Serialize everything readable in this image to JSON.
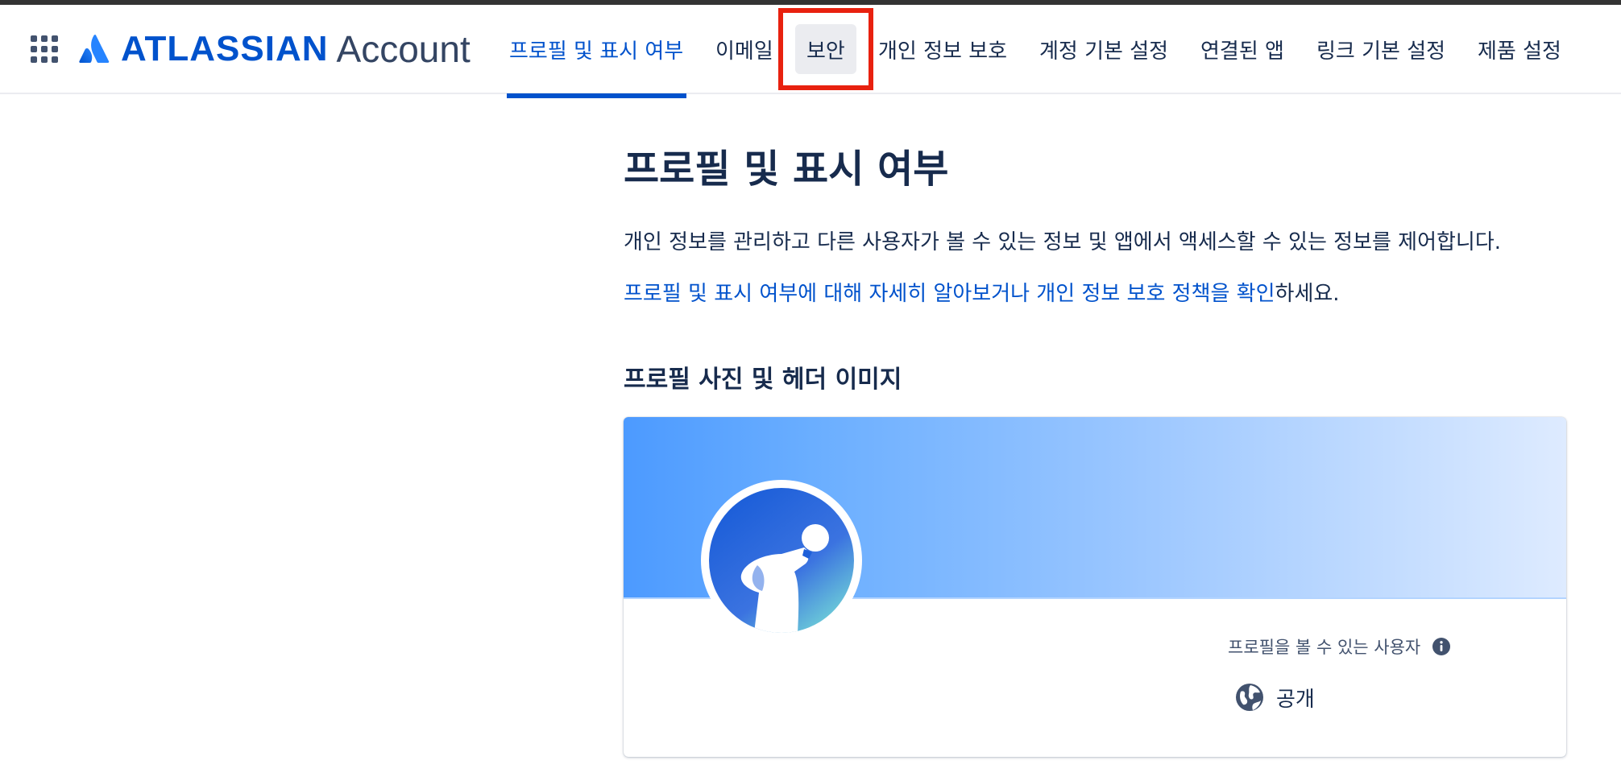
{
  "header": {
    "brand": "ATLASSIAN",
    "product": "Account",
    "tabs": [
      {
        "label": "프로필 및 표시 여부",
        "active": true
      },
      {
        "label": "이메일"
      },
      {
        "label": "보안"
      },
      {
        "label": "개인 정보 보호"
      },
      {
        "label": "계정 기본 설정"
      },
      {
        "label": "연결된 앱"
      },
      {
        "label": "링크 기본 설정"
      },
      {
        "label": "제품 설정"
      }
    ]
  },
  "main": {
    "title": "프로필 및 표시 여부",
    "description": "개인 정보를 관리하고 다른 사용자가 볼 수 있는 정보 및 앱에서 액세스할 수 있는 정보를 제어합니다.",
    "learn_more_link": "프로필 및 표시 여부에 대해 자세히 알아보거나",
    "privacy_link": "개인 정보 보호 정책을 확인",
    "links_suffix": "하세요.",
    "section_title": "프로필 사진 및 헤더 이미지",
    "visibility_label": "프로필을 볼 수 있는 사용자",
    "visibility_value": "공개"
  },
  "icons": {
    "app_switcher": "app-switcher-icon",
    "logo": "atlassian-logo-icon",
    "info": "info-icon",
    "globe": "globe-icon",
    "avatar": "avatar-dog-icon"
  },
  "colors": {
    "accent": "#0052CC",
    "text": "#172B4D",
    "highlight": "#E8210F"
  }
}
